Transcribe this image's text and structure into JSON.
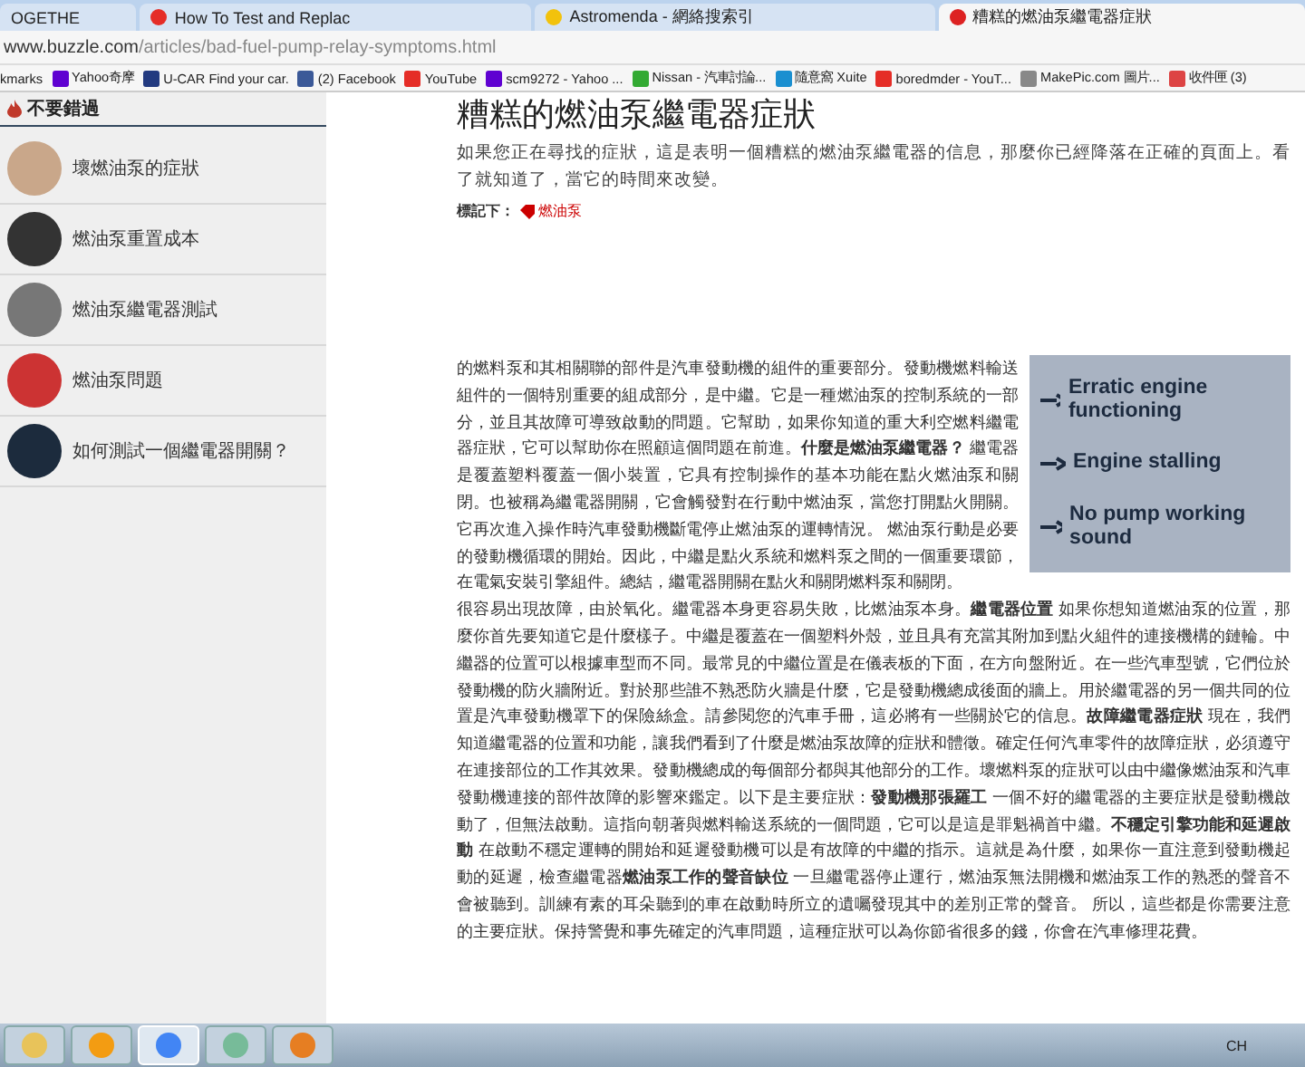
{
  "browser": {
    "tabs": [
      {
        "title": "OGETHE",
        "selected": false,
        "kind": "plain"
      },
      {
        "title": "How To Test and Replac",
        "selected": false,
        "kind": "video"
      },
      {
        "title": "Astromenda - 網絡搜索引",
        "selected": false,
        "kind": "globe"
      },
      {
        "title": "糟糕的燃油泵繼電器症狀",
        "selected": true,
        "kind": "page"
      }
    ],
    "url": {
      "host": "www.buzzle.com",
      "path": "/articles/bad-fuel-pump-relay-symptoms.html"
    },
    "bookmarks": [
      {
        "label": "kmarks",
        "kind": "none"
      },
      {
        "label": "Yahoo奇摩",
        "kind": "yahoo"
      },
      {
        "label": "U-CAR Find your car.",
        "kind": "ucar"
      },
      {
        "label": "(2) Facebook",
        "kind": "facebook"
      },
      {
        "label": "YouTube",
        "kind": "video"
      },
      {
        "label": "scm9272 - Yahoo ...",
        "kind": "mail"
      },
      {
        "label": "Nissan - 汽車討論...",
        "kind": "forum"
      },
      {
        "label": "隨意窩 Xuite",
        "kind": "xuite"
      },
      {
        "label": "boredmder - YouT...",
        "kind": "video"
      },
      {
        "label": "MakePic.com 圖片...",
        "kind": "page"
      },
      {
        "label": "收件匣 (3)",
        "kind": "gmail"
      }
    ]
  },
  "sidebar": {
    "heading": "不要錯過",
    "items": [
      {
        "label": "壞燃油泵的症狀"
      },
      {
        "label": "燃油泵重置成本"
      },
      {
        "label": "燃油泵繼電器測試"
      },
      {
        "label": "燃油泵問題"
      },
      {
        "label": "如何測試一個繼電器開關？"
      }
    ]
  },
  "article": {
    "title": "糟糕的燃油泵繼電器症狀",
    "summary": "如果您正在尋找的症狀，這是表明一個糟糕的燃油泵繼電器的信息，那麼你已經降落在正確的頁面上。看了就知道了，當它的時間來改變。",
    "tag_label": "標記下：",
    "tag": "燃油泵",
    "figure_lines": [
      "Erratic engine functioning",
      "Engine stalling",
      "No pump working sound"
    ],
    "body": [
      "的燃料泵和其相關聯的部件是汽車發動機的組件的重要部分。發動機燃料輸送組件的一個特別重要的組成部分，是中繼。它是一種燃油泵的控制系統的一部分，並且其故障可導致啟動的問題。它幫助，如果你知道的重大利空燃料繼電器症狀，它可以幫助你在照顧這個問題在前進。**什麼是燃油泵繼電器？** 繼電器是覆蓋塑料覆蓋一個小裝置，它具有控制操作的基本功能在點火燃油泵和關閉。也被稱為繼電器開關，它會觸發對在行動中燃油泵，當您打開點火開關。它再次進入操作時汽車發動機斷電停止燃油泵的運轉情況。 燃油泵行動是必要的發動機循環的開始。因此，中繼是點火系統和燃料泵之間的一個重要環節，在電氣安裝引擎組件。總結，繼電器開關在點火和關閉燃料泵和關閉。",
      "很容易出現故障，由於氧化。繼電器本身更容易失敗，比燃油泵本身。**繼電器位置** 如果你想知道燃油泵的位置，那麼你首先要知道它是什麼樣子。中繼是覆蓋在一個塑料外殼，並且具有充當其附加到點火組件的連接機構的鏈輪。中繼器的位置可以根據車型而不同。最常見的中繼位置是在儀表板的下面，在方向盤附近。在一些汽車型號，它們位於發動機的防火牆附近。對於那些誰不熟悉防火牆是什麼，它是發動機總成後面的牆上。用於繼電器的另一個共同的位置是汽車發動機罩下的保險絲盒。請參閱您的汽車手冊，這必將有一些關於它的信息。**故障繼電器症狀** 現在，我們知道繼電器的位置和功能，讓我們看到了什麼是燃油泵故障的症狀和體徵。確定任何汽車零件的故障症狀，必須遵守在連接部位的工作其效果。發動機總成的每個部分都與其他部分的工作。壞燃料泵的症狀可以由中繼像燃油泵和汽車發動機連接的部件故障的影響來鑑定。以下是主要症狀：**發動機那張羅工** 一個不好的繼電器的主要症狀是發動機啟動了，但無法啟動。這指向朝著與燃料輸送系統的一個問題，它可以是這是罪魁禍首中繼。**不穩定引擎功能和延遲啟動** 在啟動不穩定運轉的開始和延遲發動機可以是有故障的中繼的指示。這就是為什麼，如果你一直注意到發動機起動的延遲，檢查繼電器**燃油泵工作的聲音缺位** 一旦繼電器停止運行，燃油泵無法開機和燃油泵工作的熟悉的聲音不會被聽到。訓練有素的耳朵聽到的車在啟動時所立的遺囑發現其中的差別正常的聲音。 所以，這些都是你需要注意的主要症狀。保持警覺和事先確定的汽車問題，這種症狀可以為你節省很多的錢，你會在汽車修理花費。"
    ]
  },
  "taskbar": {
    "apps": [
      {
        "kind": "folder",
        "selected": false
      },
      {
        "kind": "mail",
        "selected": false
      },
      {
        "kind": "browser",
        "selected": true
      },
      {
        "kind": "paint",
        "selected": false
      },
      {
        "kind": "camera",
        "selected": false
      }
    ],
    "language": "CH"
  }
}
